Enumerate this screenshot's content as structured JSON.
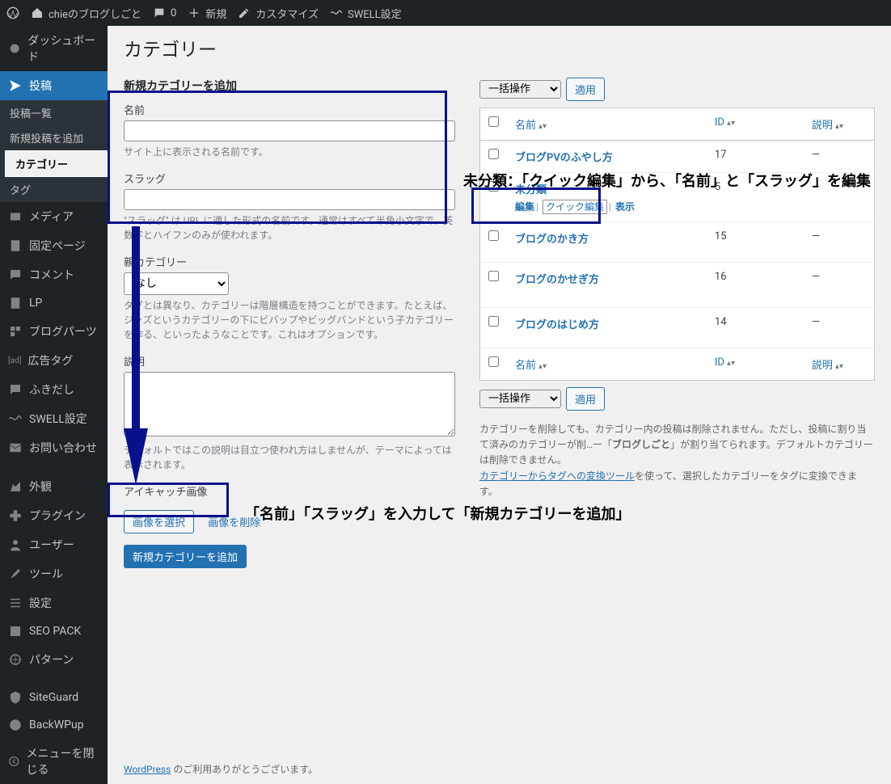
{
  "adminbar": {
    "site_name": "chieのブログしごと",
    "comments": "0",
    "new": "新規",
    "customize": "カスタマイズ",
    "swell_settings": "SWELL設定"
  },
  "sidebar": {
    "dashboard": "ダッシュボード",
    "posts": "投稿",
    "posts_sub": {
      "all": "投稿一覧",
      "add": "新規投稿を追加",
      "category": "カテゴリー",
      "tag": "タグ"
    },
    "media": "メディア",
    "pages": "固定ページ",
    "comments": "コメント",
    "lp": "LP",
    "blog_parts": "ブログパーツ",
    "ad_tag": "広告タグ",
    "fukidashi": "ふきだし",
    "swell": "SWELL設定",
    "contact": "お問い合わせ",
    "appearance": "外観",
    "plugins": "プラグイン",
    "users": "ユーザー",
    "tools": "ツール",
    "settings": "設定",
    "seopack": "SEO PACK",
    "pattern": "パターン",
    "siteguard": "SiteGuard",
    "backwpup": "BackWPup",
    "collapse": "メニューを閉じる"
  },
  "page": {
    "title": "カテゴリー",
    "add_heading": "新規カテゴリーを追加",
    "name_label": "名前",
    "name_desc": "サイト上に表示される名前です。",
    "slug_label": "スラッグ",
    "slug_desc": "\"スラッグ\" は URL に適した形式の名前です。通常はすべて半角小文字で、英数字とハイフンのみが使われます。",
    "parent_label": "親カテゴリー",
    "parent_none": "なし",
    "parent_desc": "タグとは異なり、カテゴリーは階層構造を持つことができます。たとえば、ジャズというカテゴリーの下にビバップやビッグバンドという子カテゴリーを作る、といったようなことです。これはオプションです。",
    "desc_label": "説明",
    "desc_desc": "デフォルトではこの説明は目立つ使われ方はしませんが、テーマによっては表示されます。",
    "eyecatch_label": "アイキャッチ画像",
    "select_image": "画像を選択",
    "delete_image": "画像を削除",
    "submit": "新規カテゴリーを追加"
  },
  "bulk": {
    "label": "一括操作",
    "apply": "適用"
  },
  "table": {
    "col_name": "名前",
    "col_id": "ID",
    "col_desc": "説明",
    "rows": [
      {
        "name": "ブログPVのふやし方",
        "id": "17",
        "desc": "—"
      },
      {
        "name": "未分類",
        "id": "5",
        "desc": "—",
        "actions": {
          "edit": "編集",
          "quick": "クイック編集",
          "view": "表示"
        }
      },
      {
        "name": "ブログのかき方",
        "id": "15",
        "desc": "—"
      },
      {
        "name": "ブログのかせぎ方",
        "id": "16",
        "desc": "—"
      },
      {
        "name": "ブログのはじめ方",
        "id": "14",
        "desc": "—"
      }
    ]
  },
  "note": {
    "line1_a": "カテゴリーを削除しても、カテゴリー内の投稿は削除されません。ただし、投稿に割り当て済みのカテゴリーが削…ー「",
    "line1_b": "ブログしごと",
    "line1_c": "」が割り当てられます。デフォルトカテゴリーは削除できません。",
    "line2_link": "カテゴリーからタグへの変換ツール",
    "line2_rest": "を使って、選択したカテゴリーをタグに変換できます。"
  },
  "footer": {
    "wp": "WordPress",
    "thanks": " のご利用ありがとうございます。"
  },
  "annotations": {
    "right_text": "未分類：「クイック編集」から、「名前」と「スラッグ」を編集",
    "bottom_text": "「名前」「スラッグ」を入力して「新規カテゴリーを追加」"
  }
}
